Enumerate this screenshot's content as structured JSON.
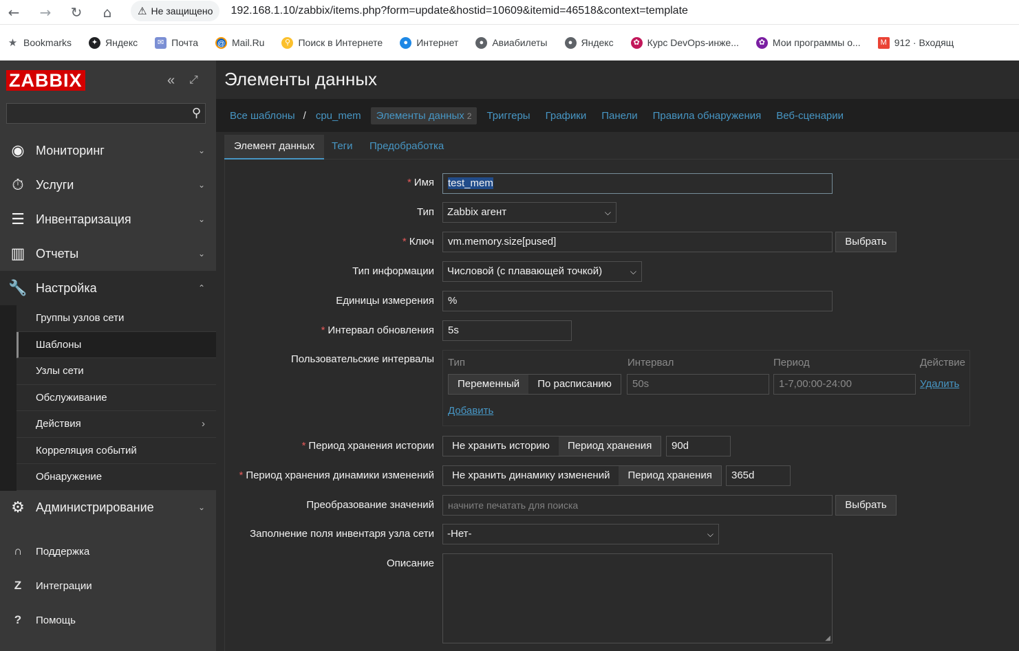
{
  "browser": {
    "security_label": "Не защищено",
    "url": "192.168.1.10/zabbix/items.php?form=update&hostid=10609&itemid=46518&context=template",
    "bookmarks": [
      {
        "label": "Bookmarks",
        "icon": "star-icon"
      },
      {
        "label": "Яндекс",
        "icon": "yandex-icon"
      },
      {
        "label": "Почта",
        "icon": "mail-icon"
      },
      {
        "label": "Mail.Ru",
        "icon": "mailru-icon"
      },
      {
        "label": "Поиск в Интернете",
        "icon": "search-web-icon"
      },
      {
        "label": "Интернет",
        "icon": "globe-icon"
      },
      {
        "label": "Авиабилеты",
        "icon": "globe-icon"
      },
      {
        "label": "Яндекс",
        "icon": "globe-icon"
      },
      {
        "label": "Курс DevOps-инже...",
        "icon": "course-icon"
      },
      {
        "label": "Мои программы о...",
        "icon": "course-icon"
      },
      {
        "label": "912 · Входящ",
        "icon": "gmail-icon"
      }
    ]
  },
  "sidebar": {
    "logo": "ZABBIX",
    "search_placeholder": "",
    "menu": [
      {
        "label": "Мониторинг",
        "icon": "eye-icon"
      },
      {
        "label": "Услуги",
        "icon": "stopwatch-icon"
      },
      {
        "label": "Инвентаризация",
        "icon": "list-icon"
      },
      {
        "label": "Отчеты",
        "icon": "bar-chart-icon"
      },
      {
        "label": "Настройка",
        "icon": "wrench-icon"
      },
      {
        "label": "Администрирование",
        "icon": "gear-icon"
      }
    ],
    "submenu": [
      {
        "label": "Группы узлов сети"
      },
      {
        "label": "Шаблоны"
      },
      {
        "label": "Узлы сети"
      },
      {
        "label": "Обслуживание"
      },
      {
        "label": "Действия"
      },
      {
        "label": "Корреляция событий"
      },
      {
        "label": "Обнаружение"
      }
    ],
    "footer": [
      {
        "label": "Поддержка",
        "icon": "headset-icon"
      },
      {
        "label": "Интеграции",
        "icon": "z-icon"
      },
      {
        "label": "Помощь",
        "icon": "question-icon"
      }
    ]
  },
  "page": {
    "title": "Элементы данных"
  },
  "breadcrumbs": {
    "all_templates": "Все шаблоны",
    "separator": "/",
    "template": "cpu_mem",
    "items": "Элементы данных",
    "items_count": "2",
    "triggers": "Триггеры",
    "graphs": "Графики",
    "dashboards": "Панели",
    "discovery": "Правила обнаружения",
    "web": "Веб-сценарии"
  },
  "tabs": {
    "item": "Элемент данных",
    "tags": "Теги",
    "preprocessing": "Предобработка"
  },
  "form": {
    "name_label": "Имя",
    "name_value": "test_mem",
    "type_label": "Тип",
    "type_value": "Zabbix агент",
    "key_label": "Ключ",
    "key_value": "vm.memory.size[pused]",
    "select_button": "Выбрать",
    "info_type_label": "Тип информации",
    "info_type_value": "Числовой (с плавающей точкой)",
    "units_label": "Единицы измерения",
    "units_value": "%",
    "interval_label": "Интервал обновления",
    "interval_value": "5s",
    "custom_intervals_label": "Пользовательские интервалы",
    "ci_head_type": "Тип",
    "ci_head_interval": "Интервал",
    "ci_head_period": "Период",
    "ci_head_action": "Действие",
    "ci_flexible": "Переменный",
    "ci_scheduling": "По расписанию",
    "ci_interval_value": "50s",
    "ci_period_value": "1-7,00:00-24:00",
    "ci_remove": "Удалить",
    "ci_add": "Добавить",
    "history_label": "Период хранения истории",
    "history_do_not_keep": "Не хранить историю",
    "history_storage_period": "Период хранения",
    "history_value": "90d",
    "trends_label": "Период хранения динамики изменений",
    "trends_do_not_keep": "Не хранить динамику изменений",
    "trends_storage_period": "Период хранения",
    "trends_value": "365d",
    "valuemap_label": "Преобразование значений",
    "valuemap_placeholder": "начните печатать для поиска",
    "inventory_label": "Заполнение поля инвентаря узла сети",
    "inventory_value": "-Нет-",
    "description_label": "Описание"
  }
}
